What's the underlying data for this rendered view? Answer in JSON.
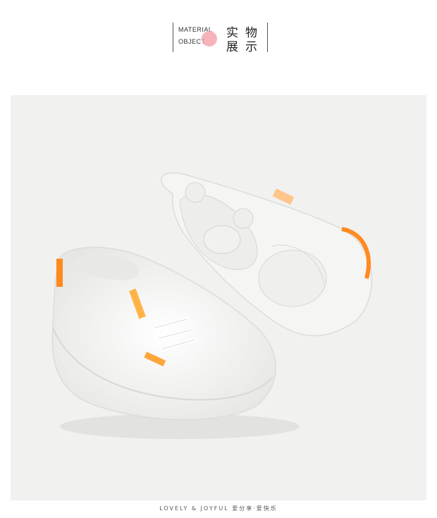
{
  "header": {
    "en_line1": "MATERIAL",
    "en_line2": "OBJECT",
    "zh_char1": "实",
    "zh_char2": "物",
    "zh_char3": "展",
    "zh_char4": "示",
    "accent_color": "#f4a6ae"
  },
  "footer": {
    "text": "LOVELY & JOYFUL 爱分享·爱快乐"
  }
}
